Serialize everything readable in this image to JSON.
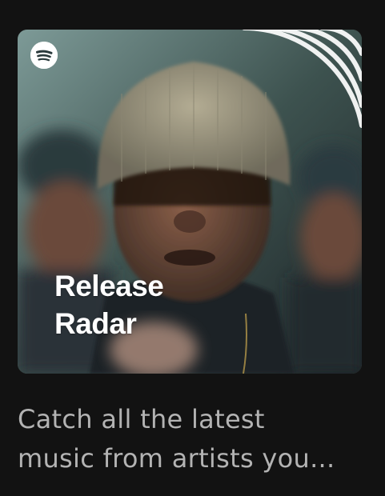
{
  "playlist": {
    "title_line1": "Release",
    "title_line2": "Radar",
    "description_line1": "Catch all the latest",
    "description_line2": "music from artists you...",
    "logo_icon": "spotify-logo-icon",
    "accent_color": "#1db954"
  }
}
